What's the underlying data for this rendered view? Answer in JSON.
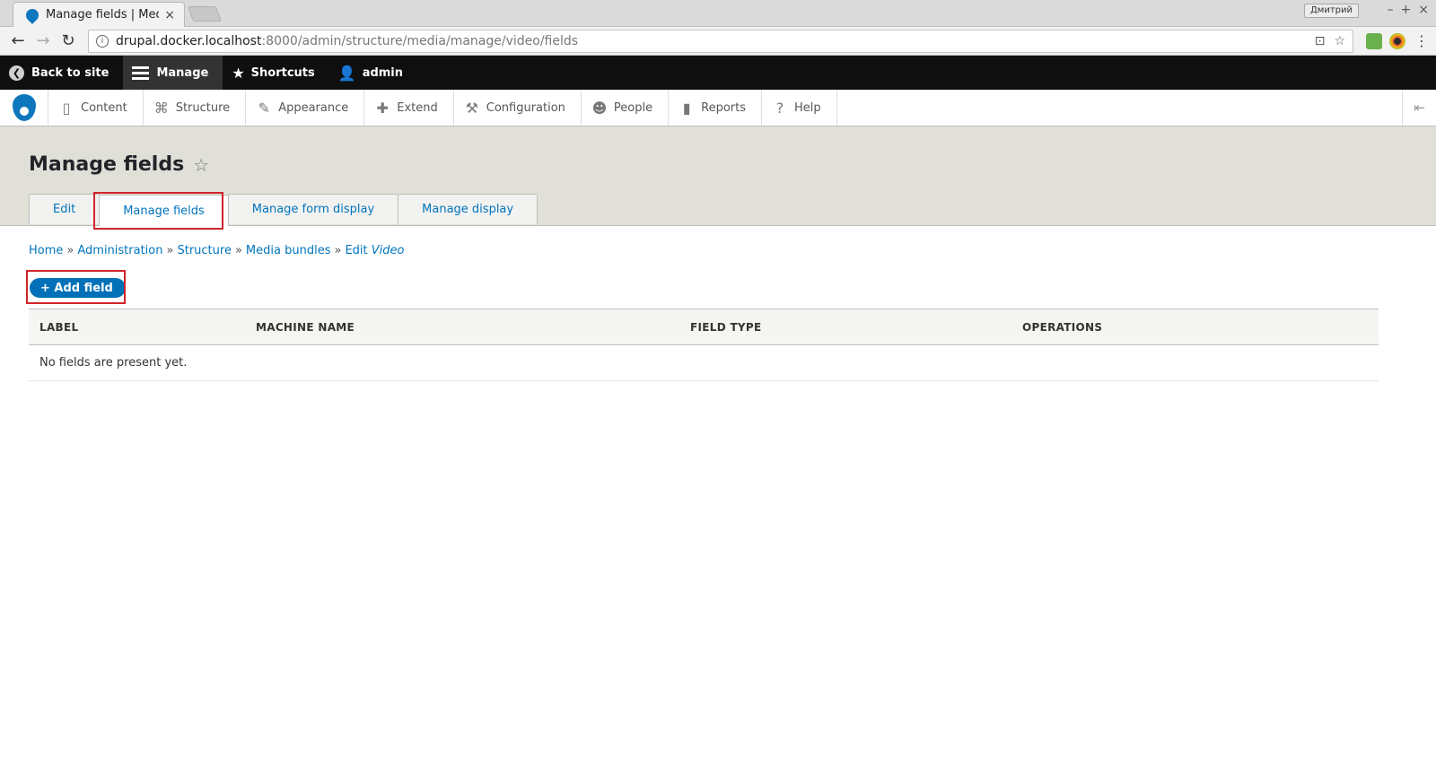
{
  "browser": {
    "tab_title": "Manage fields | Media",
    "tab_close": "×",
    "profile_name": "Дмитрий",
    "window_controls": [
      "–",
      "+",
      "×"
    ],
    "url_host": "drupal.docker.localhost",
    "url_path": ":8000/admin/structure/media/manage/video/fields"
  },
  "toolbar": {
    "back_to_site": "Back to site",
    "manage": "Manage",
    "shortcuts": "Shortcuts",
    "user": "admin"
  },
  "tray": {
    "items": [
      {
        "label": "Content",
        "icon": "file-icon"
      },
      {
        "label": "Structure",
        "icon": "structure-icon"
      },
      {
        "label": "Appearance",
        "icon": "brush-icon"
      },
      {
        "label": "Extend",
        "icon": "puzzle-icon"
      },
      {
        "label": "Configuration",
        "icon": "wrench-icon"
      },
      {
        "label": "People",
        "icon": "people-icon"
      },
      {
        "label": "Reports",
        "icon": "bar-chart-icon"
      },
      {
        "label": "Help",
        "icon": "help-icon"
      }
    ]
  },
  "page": {
    "title": "Manage fields",
    "tabs": [
      "Edit",
      "Manage fields",
      "Manage form display",
      "Manage display"
    ],
    "active_tab": "Manage fields"
  },
  "breadcrumb": {
    "items": [
      "Home",
      "Administration",
      "Structure",
      "Media bundles"
    ],
    "last_prefix": "Edit",
    "last_em": "Video",
    "separator": "»"
  },
  "actions": {
    "add_field": "+ Add field"
  },
  "table": {
    "headers": [
      "LABEL",
      "MACHINE NAME",
      "FIELD TYPE",
      "OPERATIONS"
    ],
    "empty_message": "No fields are present yet."
  },
  "colors": {
    "link": "#0074bd",
    "button": "#0071b8",
    "highlight": "#d0242b",
    "toolbar_bg": "#0f0f0f"
  }
}
